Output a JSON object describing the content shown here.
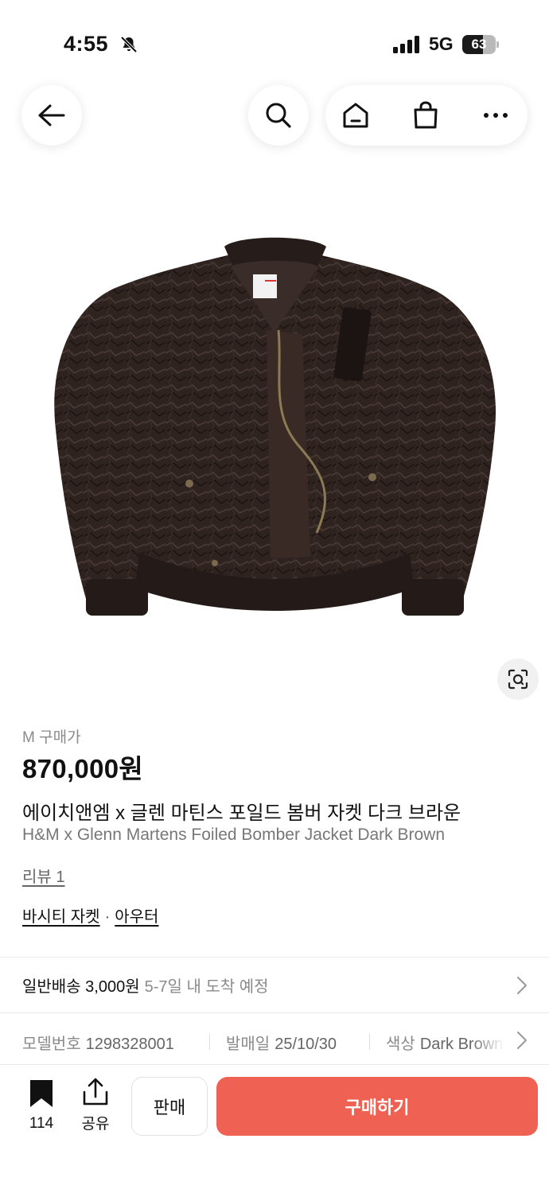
{
  "status_bar": {
    "time": "4:55",
    "network": "5G",
    "battery": "63",
    "battery_level": 0.63
  },
  "nav": {
    "icons": [
      "back-arrow-icon",
      "search-icon",
      "home-icon",
      "shopping-bag-icon",
      "more-icon"
    ]
  },
  "product": {
    "size_label": "M 구매가",
    "price": "870,000원",
    "name_ko": "에이치앤엠 x 글렌 마틴스 포일드 봄버 자켓 다크 브라운",
    "name_en": "H&M x Glenn Martens Foiled Bomber Jacket Dark Brown",
    "review": "리뷰 1",
    "category_1": "바시티 자켓",
    "category_sep": "·",
    "category_2": "아우터"
  },
  "shipping": {
    "label": "일반배송 3,000원",
    "eta": "5-7일 내 도착 예정"
  },
  "specs": [
    {
      "label": "모델번호",
      "value": "1298328001"
    },
    {
      "label": "발매일",
      "value": "25/10/30"
    },
    {
      "label": "색상",
      "value": "Dark Brown"
    }
  ],
  "bottom_bar": {
    "wish_count": "114",
    "share_label": "공유",
    "sell_label": "판매",
    "buy_label": "구매하기"
  },
  "colors": {
    "buy_button": "#ef6253",
    "jacket": "#2f2320"
  }
}
